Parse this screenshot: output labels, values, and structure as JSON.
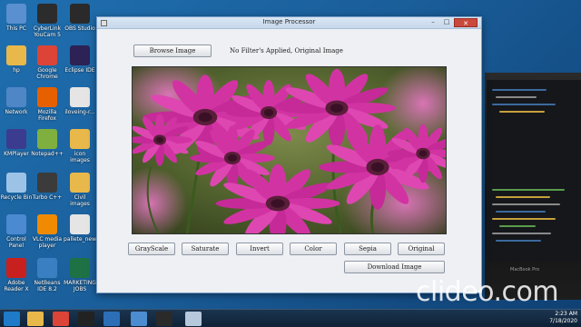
{
  "desktop": {
    "icons": [
      {
        "label": "This PC",
        "icon": "computer-icon",
        "color": "#5a8fd0"
      },
      {
        "label": "CyberLink YouCam 5",
        "icon": "youcam-icon",
        "color": "#2c2c2c"
      },
      {
        "label": "OBS Studio",
        "icon": "obs-icon",
        "color": "#2a2a2a"
      },
      {
        "label": "hp",
        "icon": "folder-icon",
        "color": "#e8b84a"
      },
      {
        "label": "Google Chrome",
        "icon": "chrome-icon",
        "color": "#db4437"
      },
      {
        "label": "Eclipse IDE",
        "icon": "eclipse-icon",
        "color": "#2c2255"
      },
      {
        "label": "Network",
        "icon": "network-icon",
        "color": "#4f86c6"
      },
      {
        "label": "Mozilla Firefox",
        "icon": "firefox-icon",
        "color": "#e66000"
      },
      {
        "label": "iloveing-r...",
        "icon": "file-icon",
        "color": "#e5e5e5"
      },
      {
        "label": "KMPlayer",
        "icon": "kmplayer-icon",
        "color": "#3b3b8f"
      },
      {
        "label": "Notepad++",
        "icon": "notepad-icon",
        "color": "#7fb03f"
      },
      {
        "label": "icon images",
        "icon": "folder-icon",
        "color": "#e8b84a"
      },
      {
        "label": "Recycle Bin",
        "icon": "recycle-bin-icon",
        "color": "#9cc3e6"
      },
      {
        "label": "Turbo C++",
        "icon": "turbo-cpp-icon",
        "color": "#3b3b3b"
      },
      {
        "label": "Civil images",
        "icon": "folder-icon",
        "color": "#e8b84a"
      },
      {
        "label": "Control Panel",
        "icon": "control-panel-icon",
        "color": "#4b8ad1"
      },
      {
        "label": "VLC media player",
        "icon": "vlc-icon",
        "color": "#f08a00"
      },
      {
        "label": "pallete_new",
        "icon": "file-icon",
        "color": "#e5e5e5"
      },
      {
        "label": "Adobe Reader X",
        "icon": "adobe-reader-icon",
        "color": "#c8201e"
      },
      {
        "label": "NetBeans IDE 8.2",
        "icon": "netbeans-icon",
        "color": "#3a7fc2"
      },
      {
        "label": "MARKETING JOBS",
        "icon": "excel-icon",
        "color": "#1e7145"
      }
    ]
  },
  "window": {
    "title": "Image Processor",
    "close_label": "✕",
    "min_label": "–",
    "max_label": "□"
  },
  "toolbar": {
    "browse_label": "Browse Image",
    "status": "No Filter's Applied, Original Image"
  },
  "filters": [
    {
      "label": "GrayScale",
      "name": "grayscale-button"
    },
    {
      "label": "Saturate",
      "name": "saturate-button"
    },
    {
      "label": "Invert",
      "name": "invert-button"
    },
    {
      "label": "Color",
      "name": "color-button"
    },
    {
      "label": "Sepia",
      "name": "sepia-button"
    },
    {
      "label": "Original",
      "name": "original-button"
    }
  ],
  "download_label": "Download Image",
  "background_laptop_label": "MacBook Pro",
  "taskbar": {
    "time": "2:23 AM",
    "date": "7/18/2020"
  },
  "watermark": "clideo.com",
  "colors": {
    "accent": "#1f6fb0",
    "window_bg": "#eef0f3",
    "flower": "#d63aa8"
  }
}
